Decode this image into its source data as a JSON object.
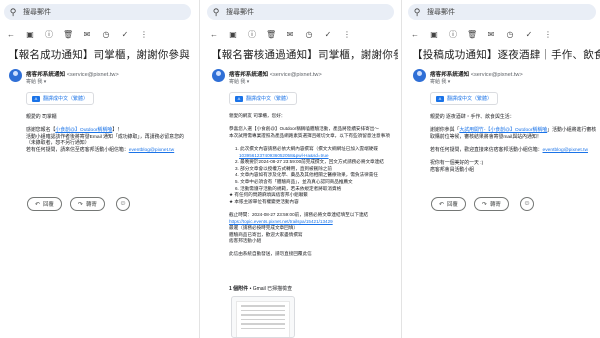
{
  "panels": [
    {
      "search": "搜尋郵件",
      "subject": "【報名成功通知】司掌櫃，謝謝你參與「大腦",
      "sender_name": "痞客邦系統通知",
      "sender_email": "<service@pixnet.tw>",
      "recipient": "寄給 我 ▾",
      "translate": "翻譯成中文（繁體）",
      "body": [
        "親愛的 司掌櫃",
        "",
        "感謝您報名【",
        "活動小組確認該作者後將寄發Email 通知「成功錄取」，再請務必留意您的",
        "（未錄取者，恕不另行通知）",
        "若有任何疑問，請來信至痞客邦活動小組信箱："
      ],
      "link1": "小食創@】Outdoor稱稱嗑",
      "after_link1": "】！",
      "email": "eventblog@pixnet.tw",
      "reply": "回覆",
      "forward": "轉寄"
    },
    {
      "search": "搜尋郵件",
      "subject": "【報名審核通過通知】司掌櫃，謝謝你參與「",
      "sender_name": "痞客邦系統通知",
      "sender_email": "<service@pixnet.tw>",
      "recipient": "寄給 我 ▾",
      "translate": "翻譯成中文（繁體）",
      "body": [
        "親愛的網友 司掌櫃，您好：",
        "",
        "恭喜您入選【小食創@】Outdoor稱稱嗑體驗活動，產品將陸續安排寄出～",
        "本次試用需專業證照為產品網路素質選擇且確切文章，以下有些須留意注意事項",
        "",
        "1. 此次撰文內容請務必依大綱內容撰寫（撰文大綱網址已加入雲端硬碟",
        "2. 最晚要於2024-08-27 23:59:00前完成撰文，回文方式請務必將文章連結",
        "3. 部分文章會以授權方式轉用，直到被刪除之前",
        "4. 文章內容如有涉及化學、藥品及其他相關之醫療效果，需負法律責任",
        "5. 文章中必須含有「體驗商品」，並為真心認同商品推薦文",
        "6. 活動需遵守活動的規範，若未依規定者將取消資格",
        "★ 有任何的問題麻煩與痞客邦小組聯繫",
        "★ 本賬主辦單位有權變更活動內容",
        "",
        "最遲（請務必按時完成文章回填）",
        "",
        "痞客邦活動小組"
      ],
      "link1": "103956123740936052058&pwl-Ha&sd=true",
      "deadline": "截止時間：2024-08-27 23:59:00前，請務必將文章連結填至以下連結",
      "link2": "https://topic.events.pixnet.net/trailspa/15421/13429",
      "closing": "體驗商品已寄出，歡迎大家盡情撰寫",
      "footer": "此信由系統自動發送，請勿直接回覆此信",
      "attachments": "1 個附件",
      "scanned": "• Gmail 已掃描檢查",
      "reply": "回覆",
      "forward": "轉寄"
    },
    {
      "search": "搜尋郵件",
      "subject": "【投稿成功通知】逐夜酒肆｜手作、飲食與生活",
      "sender_name": "痞客邦系統通知",
      "sender_email": "<service@pixnet.tw>",
      "recipient": "寄給 我 ▾",
      "translate": "翻譯成中文（繁體）",
      "body": [
        "親愛的 逐夜酒肆・手作、飲食與生活：",
        "",
        "謝謝你參與「",
        "取購前位等候，審核結果將會寄發mail與站內通知！",
        "",
        "若有任何疑問，歡迎直接來信痞客邦活動小組信箱：",
        "",
        "祝你有一個美好的一天 :)",
        "痞客邦會員活動小組"
      ],
      "link1": "大試用開竹-【小食創@】Outdoor稱稱嗑",
      "after_link1": "」活動小組將進行審核",
      "email": "eventblog@pixnet.tw",
      "reply": "回覆",
      "forward": "轉寄"
    }
  ],
  "colors": {
    "link": "#1a73e8",
    "avatar": "#2f6fd6",
    "search_bg": "#e9eef6"
  },
  "icons": [
    "search-icon",
    "back-icon",
    "archive-icon",
    "report-icon",
    "delete-icon",
    "mail-icon",
    "snooze-icon",
    "label-icon",
    "more-icon",
    "reply-icon",
    "forward-icon",
    "emoji-icon"
  ]
}
